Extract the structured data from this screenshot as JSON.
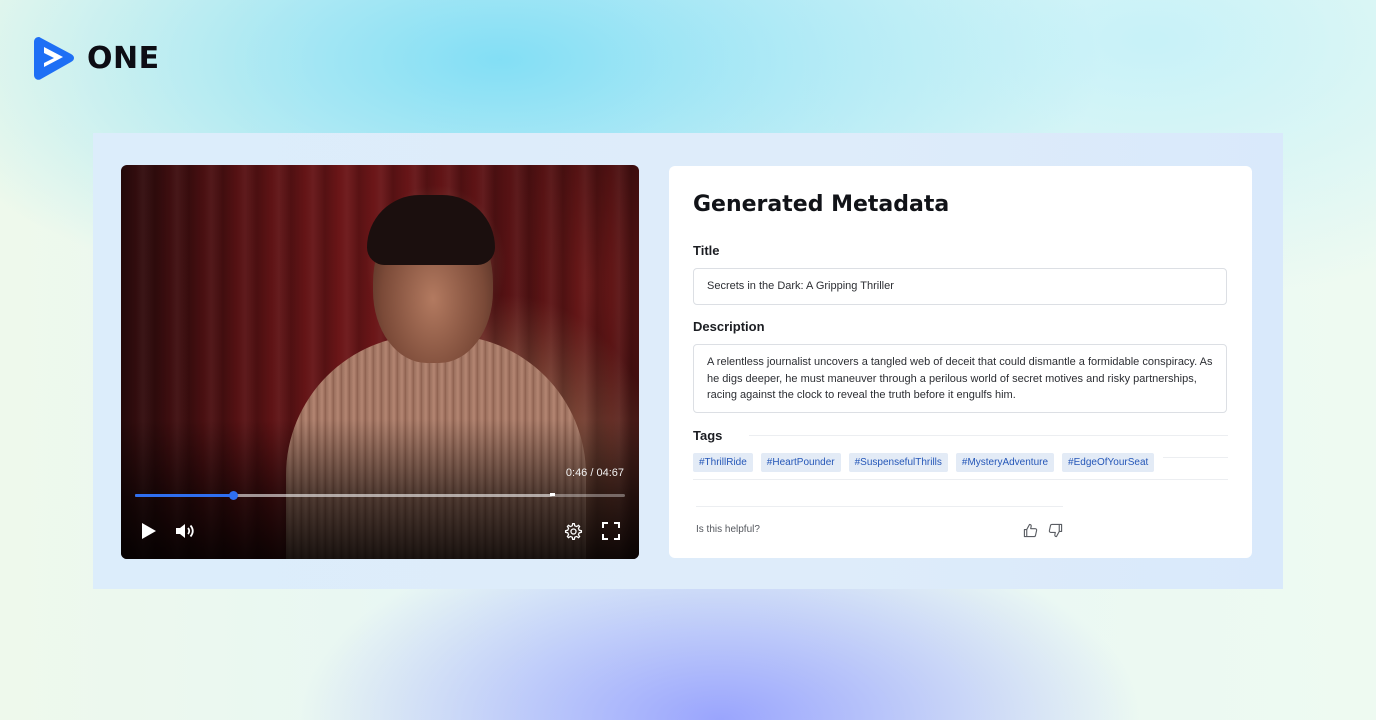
{
  "brand": {
    "name": "ONE"
  },
  "video": {
    "time_label": "0:46 / 04:67",
    "progress": 0.2,
    "buffer": 0.85,
    "accent_color": "#2f6ff0"
  },
  "metadata": {
    "heading": "Generated Metadata",
    "title_label": "Title",
    "title_value": "Secrets in the Dark: A Gripping Thriller",
    "description_label": "Description",
    "description_value": "A relentless journalist uncovers a tangled web of deceit that could dismantle a formidable conspiracy. As he digs deeper, he must maneuver through a perilous world of secret motives and risky partnerships, racing against the clock to reveal the truth before it engulfs him.",
    "tags_label": "Tags",
    "tags": [
      "#ThrillRide",
      "#HeartPounder",
      "#SuspensefulThrills",
      "#MysteryAdventure",
      "#EdgeOfYourSeat"
    ],
    "feedback_prompt": "Is this helpful?"
  },
  "icons": [
    "brand-logo-icon",
    "play-icon",
    "volume-icon",
    "settings-gear-icon",
    "fullscreen-icon",
    "thumbs-up-icon",
    "thumbs-down-icon"
  ]
}
